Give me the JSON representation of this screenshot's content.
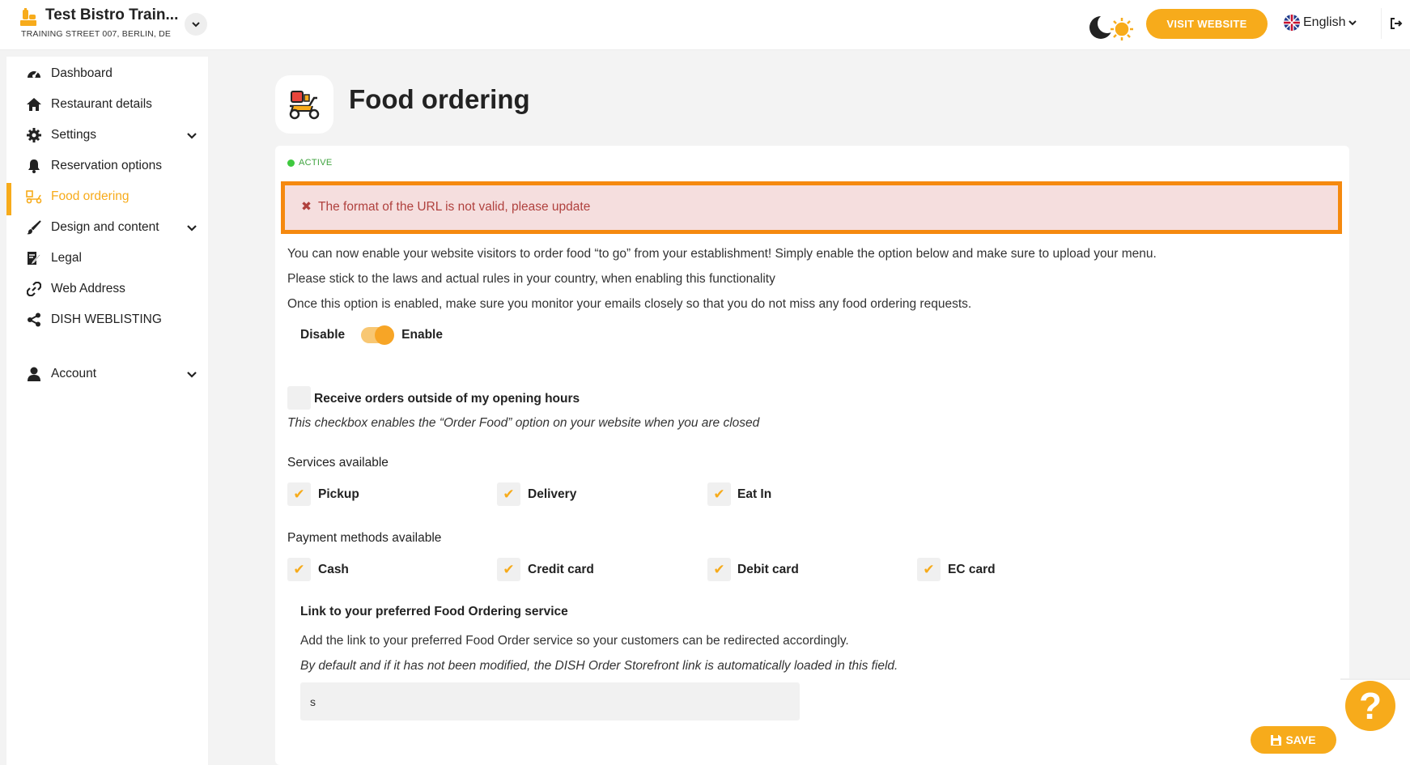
{
  "header": {
    "restaurant_name": "Test Bistro Train...",
    "restaurant_address": "TRAINING STREET 007, BERLIN, DE",
    "visit_website_label": "VISIT WEBSITE",
    "language_label": "English",
    "accent_color": "#f7ab1b"
  },
  "sidebar": {
    "items": [
      {
        "label": "Dashboard",
        "icon": "dashboard-icon"
      },
      {
        "label": "Restaurant details",
        "icon": "home-icon"
      },
      {
        "label": "Settings",
        "icon": "gear-icon"
      },
      {
        "label": "Reservation options",
        "icon": "bell-icon"
      },
      {
        "label": "Food ordering",
        "icon": "scooter-icon"
      },
      {
        "label": "Design and content",
        "icon": "brush-icon"
      },
      {
        "label": "Legal",
        "icon": "legal-icon"
      },
      {
        "label": "Web Address",
        "icon": "link-icon"
      },
      {
        "label": "DISH WEBLISTING",
        "icon": "share-icon"
      },
      {
        "label": "Account",
        "icon": "user-icon"
      }
    ]
  },
  "page": {
    "title": "Food ordering",
    "status": "ACTIVE",
    "error_message": "The format of the URL is not valid, please update",
    "intro_1": "You can now enable your website visitors to order food “to go” from your establishment! Simply enable the option below and make sure to upload your menu.",
    "intro_2": "Please stick to the laws and actual rules in your country, when enabling this functionality",
    "intro_3": "Once this option is enabled, make sure you monitor your emails closely so that you do not miss any food ordering requests.",
    "toggle": {
      "off_label": "Disable",
      "on_label": "Enable",
      "enabled": true
    },
    "outside_hours": {
      "label": "Receive orders outside of my opening hours",
      "hint": "This checkbox enables the “Order Food” option on your website when you are closed",
      "checked": false
    },
    "services": {
      "title": "Services available",
      "options": [
        {
          "label": "Pickup",
          "checked": true
        },
        {
          "label": "Delivery",
          "checked": true
        },
        {
          "label": "Eat In",
          "checked": true
        }
      ]
    },
    "payments": {
      "title": "Payment methods available",
      "options": [
        {
          "label": "Cash",
          "checked": true
        },
        {
          "label": "Credit card",
          "checked": true
        },
        {
          "label": "Debit card",
          "checked": true
        },
        {
          "label": "EC card",
          "checked": true
        }
      ]
    },
    "link": {
      "title": "Link to your preferred Food Ordering service",
      "description": "Add the link to your preferred Food Order service so your customers can be redirected accordingly.",
      "note": "By default and if it has not been modified, the DISH Order Storefront link is automatically loaded in this field.",
      "value": "s"
    },
    "save_label": "SAVE",
    "help_label": "?"
  }
}
